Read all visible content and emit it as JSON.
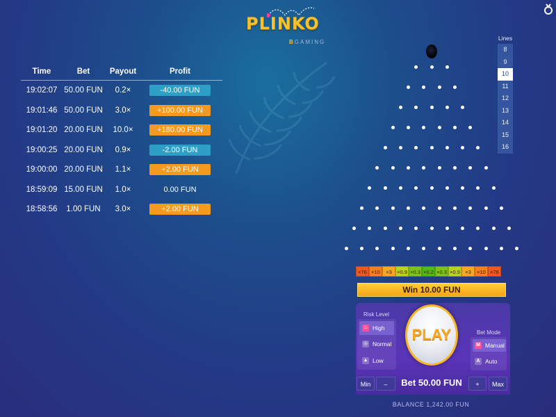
{
  "logo": {
    "title": "PLINKO",
    "subtitle_accent": "B",
    "subtitle": "GAMING"
  },
  "history": {
    "headers": {
      "time": "Time",
      "bet": "Bet",
      "payout": "Payout",
      "profit": "Profit"
    },
    "rows": [
      {
        "time": "19:02:07",
        "bet": "50.00 FUN",
        "payout": "0.2×",
        "profit": "-40.00 FUN",
        "kind": "loss"
      },
      {
        "time": "19:01:46",
        "bet": "50.00 FUN",
        "payout": "3.0×",
        "profit": "+100.00 FUN",
        "kind": "win"
      },
      {
        "time": "19:01:20",
        "bet": "20.00 FUN",
        "payout": "10.0×",
        "profit": "+180.00 FUN",
        "kind": "win"
      },
      {
        "time": "19:00:25",
        "bet": "20.00 FUN",
        "payout": "0.9×",
        "profit": "-2.00 FUN",
        "kind": "loss"
      },
      {
        "time": "19:00:00",
        "bet": "20.00 FUN",
        "payout": "1.1×",
        "profit": "+2.00 FUN",
        "kind": "win"
      },
      {
        "time": "18:59:09",
        "bet": "15.00 FUN",
        "payout": "1.0×",
        "profit": "0.00 FUN",
        "kind": "even"
      },
      {
        "time": "18:58:56",
        "bet": "1.00 FUN",
        "payout": "3.0×",
        "profit": "+2.00 FUN",
        "kind": "win"
      }
    ]
  },
  "lines": {
    "label": "Lines",
    "options": [
      "8",
      "9",
      "10",
      "11",
      "12",
      "13",
      "14",
      "15",
      "16"
    ],
    "selected": "10"
  },
  "board": {
    "rows": 10
  },
  "multipliers": [
    {
      "label": "×76",
      "color": "#f0591e"
    },
    {
      "label": "×10",
      "color": "#f58020"
    },
    {
      "label": "×3",
      "color": "#f7a81f"
    },
    {
      "label": "×0.9",
      "color": "#b8d51d"
    },
    {
      "label": "×0.3",
      "color": "#7cc41a"
    },
    {
      "label": "×0.2",
      "color": "#4fbb16"
    },
    {
      "label": "×0.3",
      "color": "#7cc41a"
    },
    {
      "label": "×0.9",
      "color": "#b8d51d"
    },
    {
      "label": "×3",
      "color": "#f7a81f"
    },
    {
      "label": "×10",
      "color": "#f58020"
    },
    {
      "label": "×76",
      "color": "#f0591e"
    }
  ],
  "win_banner": "Win 10.00 FUN",
  "risk": {
    "label": "Risk Level",
    "options": [
      {
        "label": "High",
        "icon": "flame-icon",
        "glyph": "♨"
      },
      {
        "label": "Normal",
        "icon": "balance-icon",
        "glyph": "◎"
      },
      {
        "label": "Low",
        "icon": "low-icon",
        "glyph": "▲"
      }
    ],
    "selected": "High"
  },
  "play_label": "PLAY",
  "bet_mode": {
    "label": "Bet Mode",
    "options": [
      {
        "label": "Manual",
        "glyph": "M"
      },
      {
        "label": "Auto",
        "glyph": "A"
      }
    ],
    "selected": "Manual"
  },
  "bet_controls": {
    "min": "Min",
    "minus": "–",
    "bet": "Bet 50.00 FUN",
    "plus": "+",
    "max": "Max"
  },
  "balance": "BALANCE 1,242.00 FUN",
  "colors": {
    "win": "#f39a1f",
    "loss": "#2ea0c6",
    "accent": "#f6b625"
  }
}
